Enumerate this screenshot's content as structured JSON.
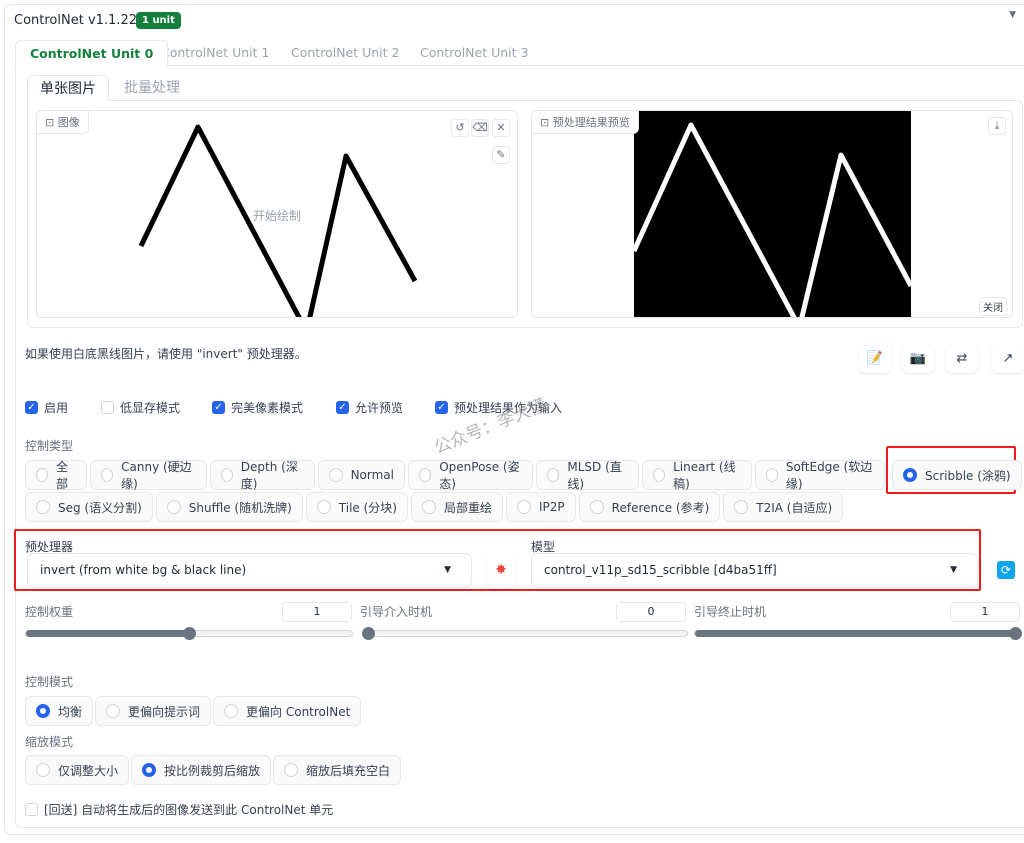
{
  "header": {
    "title": "ControlNet v1.1.224",
    "badge": "1 unit"
  },
  "unit_tabs": [
    "ControlNet Unit 0",
    "ControlNet Unit 1",
    "ControlNet Unit 2",
    "ControlNet Unit 3"
  ],
  "image_tabs": [
    "单张图片",
    "批量处理"
  ],
  "image_panel": {
    "label": "图像",
    "placeholder": "开始绘制"
  },
  "preview_panel": {
    "label": "预处理结果预览",
    "close": "关闭"
  },
  "hint": "如果使用白底黑线图片，请使用 \"invert\" 预处理器。",
  "checkboxes": [
    {
      "label": "启用",
      "checked": true
    },
    {
      "label": "低显存模式",
      "checked": false
    },
    {
      "label": "完美像素模式",
      "checked": true
    },
    {
      "label": "允许预览",
      "checked": true
    },
    {
      "label": "预处理结果作为输入",
      "checked": true
    }
  ],
  "watermark": "公众号：李大懂",
  "control_type": {
    "label": "控制类型",
    "options": [
      "全部",
      "Canny (硬边缘)",
      "Depth (深度)",
      "Normal",
      "OpenPose (姿态)",
      "MLSD (直线)",
      "Lineart (线稿)",
      "SoftEdge (软边缘)",
      "Scribble (涂鸦)",
      "Seg (语义分割)",
      "Shuffle (随机洗牌)",
      "Tile (分块)",
      "局部重绘",
      "IP2P",
      "Reference (参考)",
      "T2IA (自适应)"
    ],
    "selected": "Scribble (涂鸦)"
  },
  "preprocessor": {
    "label": "预处理器",
    "value": "invert (from white bg & black line)"
  },
  "model": {
    "label": "模型",
    "value": "control_v11p_sd15_scribble [d4ba51ff]"
  },
  "sliders": [
    {
      "label": "控制权重",
      "value": "1",
      "fraction": 0.5
    },
    {
      "label": "引导介入时机",
      "value": "0",
      "fraction": 0
    },
    {
      "label": "引导终止时机",
      "value": "1",
      "fraction": 1
    }
  ],
  "control_mode": {
    "label": "控制模式",
    "options": [
      "均衡",
      "更偏向提示词",
      "更偏向 ControlNet"
    ],
    "selected": 0
  },
  "resize_mode": {
    "label": "缩放模式",
    "options": [
      "仅调整大小",
      "按比例裁剪后缩放",
      "缩放后填充空白"
    ],
    "selected": 1
  },
  "loopback": {
    "label": "[回送] 自动将生成后的图像发送到此 ControlNet 单元",
    "checked": false
  },
  "colors": {
    "accent": "#2563eb",
    "brand": "#15803d",
    "highlight": "#ef1b1b"
  }
}
